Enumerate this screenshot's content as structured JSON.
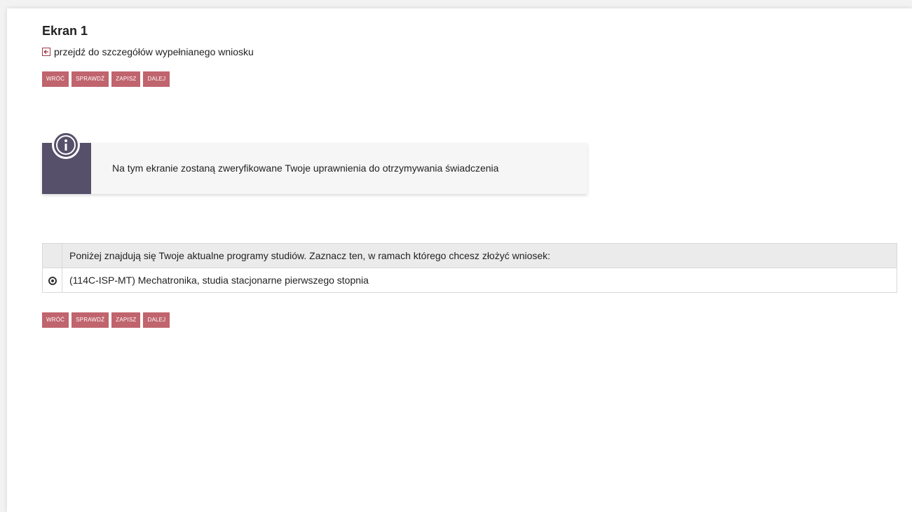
{
  "page": {
    "title": "Ekran 1",
    "details_link": "przejdź do szczegółów wypełnianego wniosku"
  },
  "buttons": {
    "back": "WRÓĆ",
    "check": "SPRAWDŹ",
    "save": "ZAPISZ",
    "next": "DALEJ"
  },
  "info": {
    "icon": "info-icon",
    "message": "Na tym ekranie zostaną zweryfikowane Twoje uprawnienia do otrzymywania świadczenia"
  },
  "programs": {
    "header": "Poniżej znajdują się Twoje aktualne programy studiów. Zaznacz ten, w ramach którego chcesz złożyć wniosek:",
    "rows": [
      {
        "label": "(114C-ISP-MT) Mechatronika, studia stacjonarne pierwszego stopnia",
        "selected": true
      }
    ]
  },
  "colors": {
    "button": "#c0646d",
    "info_accent": "#56506a"
  }
}
